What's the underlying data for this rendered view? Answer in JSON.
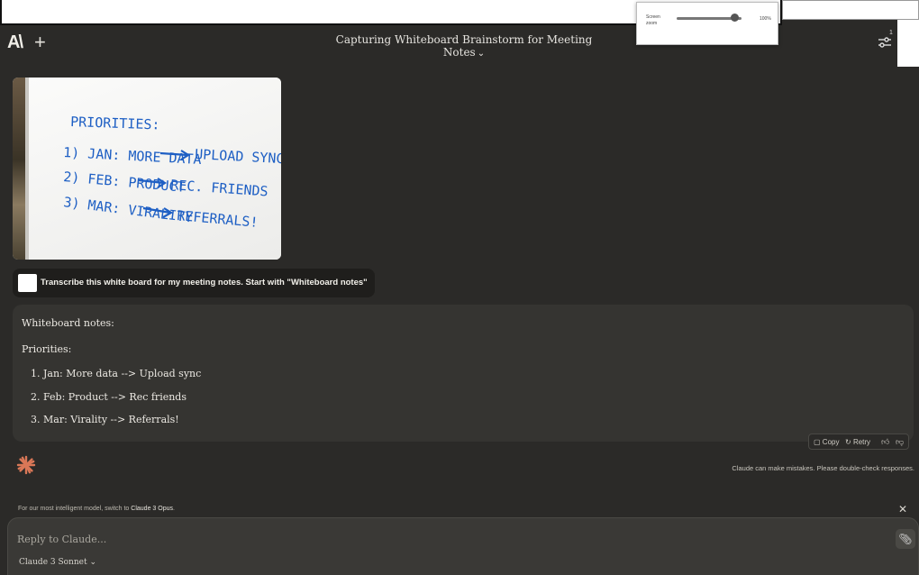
{
  "zoom": {
    "label": "Screen zoom",
    "value_text": "100%",
    "value_fraction": 0.9
  },
  "header": {
    "logo": "A\\",
    "plus": "+",
    "title": "Capturing Whiteboard Brainstorm for Meeting Notes",
    "badge": "1"
  },
  "whiteboard": {
    "heading": "PRIORITIES:",
    "lines": [
      "1) JAN: MORE DATA",
      "UPLOAD SYNC",
      "2) FEB: PRODUCT",
      "REC. FRIENDS",
      "3) MAR: VIRALITY",
      "REFERRALS!"
    ]
  },
  "user_message": {
    "text": "Transcribe this white board for my meeting notes. Start with \"Whiteboard notes\""
  },
  "assistant_message": {
    "line1": "Whiteboard notes:",
    "line2": "Priorities:",
    "items": [
      "1. Jan: More data --> Upload sync",
      "2. Feb: Product --> Rec friends",
      "3. Mar: Virality --> Referrals!"
    ]
  },
  "actions": {
    "copy": "Copy",
    "retry": "Retry"
  },
  "disclaimer": "Claude can make mistakes. Please double-check responses.",
  "upgrade_note": {
    "prefix": "For our most intelligent model, switch to ",
    "model": "Claude 3 Opus",
    "suffix": "."
  },
  "composer": {
    "placeholder": "Reply to Claude...",
    "model": "Claude 3 Sonnet"
  },
  "colors": {
    "background": "#2b2a28",
    "marker_blue": "#1e5fc4",
    "claude_orange": "#d97757"
  }
}
